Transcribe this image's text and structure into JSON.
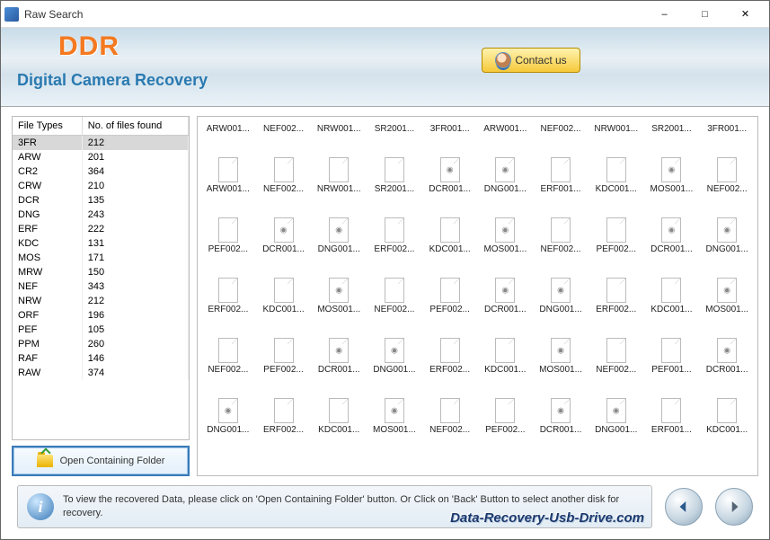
{
  "window": {
    "title": "Raw Search"
  },
  "banner": {
    "logo": "DDR",
    "subtitle": "Digital Camera Recovery",
    "contact_label": "Contact us"
  },
  "table": {
    "headers": {
      "types": "File Types",
      "count": "No. of files found"
    },
    "rows": [
      {
        "type": "3FR",
        "count": "212",
        "selected": true
      },
      {
        "type": "ARW",
        "count": "201"
      },
      {
        "type": "CR2",
        "count": "364"
      },
      {
        "type": "CRW",
        "count": "210"
      },
      {
        "type": "DCR",
        "count": "135"
      },
      {
        "type": "DNG",
        "count": "243"
      },
      {
        "type": "ERF",
        "count": "222"
      },
      {
        "type": "KDC",
        "count": "131"
      },
      {
        "type": "MOS",
        "count": "171"
      },
      {
        "type": "MRW",
        "count": "150"
      },
      {
        "type": "NEF",
        "count": "343"
      },
      {
        "type": "NRW",
        "count": "212"
      },
      {
        "type": "ORF",
        "count": "196"
      },
      {
        "type": "PEF",
        "count": "105"
      },
      {
        "type": "PPM",
        "count": "260"
      },
      {
        "type": "RAF",
        "count": "146"
      },
      {
        "type": "RAW",
        "count": "374"
      }
    ]
  },
  "open_button": "Open Containing Folder",
  "files_row1": [
    "ARW001...",
    "NEF002...",
    "NRW001...",
    "SR2001...",
    "3FR001...",
    "ARW001...",
    "NEF002...",
    "NRW001...",
    "SR2001...",
    "3FR001..."
  ],
  "file_rows": [
    {
      "names": [
        "ARW001...",
        "NEF002...",
        "NRW001...",
        "SR2001...",
        "DCR001...",
        "DNG001...",
        "ERF001...",
        "KDC001...",
        "MOS001...",
        "NEF002..."
      ],
      "cfg": [
        false,
        false,
        false,
        false,
        true,
        true,
        false,
        false,
        true,
        false
      ]
    },
    {
      "names": [
        "PEF002...",
        "DCR001...",
        "DNG001...",
        "ERF002...",
        "KDC001...",
        "MOS001...",
        "NEF002...",
        "PEF002...",
        "DCR001...",
        "DNG001..."
      ],
      "cfg": [
        false,
        true,
        true,
        false,
        false,
        true,
        false,
        false,
        true,
        true
      ]
    },
    {
      "names": [
        "ERF002...",
        "KDC001...",
        "MOS001...",
        "NEF002...",
        "PEF002...",
        "DCR001...",
        "DNG001...",
        "ERF002...",
        "KDC001...",
        "MOS001..."
      ],
      "cfg": [
        false,
        false,
        true,
        false,
        false,
        true,
        true,
        false,
        false,
        true
      ]
    },
    {
      "names": [
        "NEF002...",
        "PEF002...",
        "DCR001...",
        "DNG001...",
        "ERF002...",
        "KDC001...",
        "MOS001...",
        "NEF002...",
        "PEF001...",
        "DCR001..."
      ],
      "cfg": [
        false,
        false,
        true,
        true,
        false,
        false,
        true,
        false,
        false,
        true
      ]
    },
    {
      "names": [
        "DNG001...",
        "ERF002...",
        "KDC001...",
        "MOS001...",
        "NEF002...",
        "PEF002...",
        "DCR001...",
        "DNG001...",
        "ERF001...",
        "KDC001..."
      ],
      "cfg": [
        true,
        false,
        false,
        true,
        false,
        false,
        true,
        true,
        false,
        false
      ]
    }
  ],
  "tip": "To view the recovered Data, please click on 'Open Containing Folder' button. Or Click on 'Back' Button to select another disk for recovery.",
  "watermark": "Data-Recovery-Usb-Drive.com"
}
